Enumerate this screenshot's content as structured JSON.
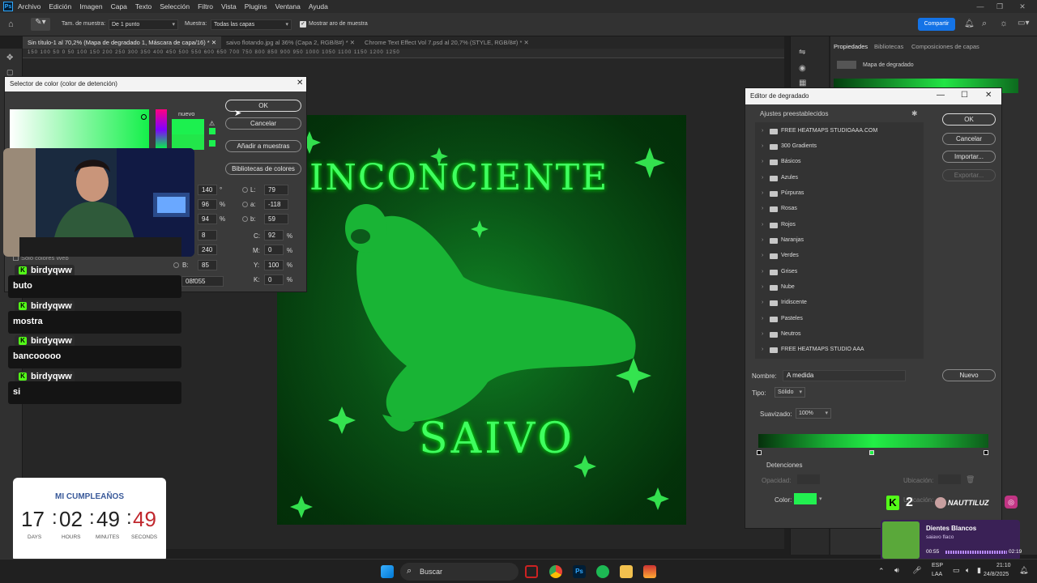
{
  "menubar": {
    "app_icon": "Ps",
    "items": [
      "Archivo",
      "Edición",
      "Imagen",
      "Capa",
      "Texto",
      "Selección",
      "Filtro",
      "Vista",
      "Plugins",
      "Ventana",
      "Ayuda"
    ]
  },
  "options": {
    "sample_size_label": "Tam. de muestra:",
    "sample_size_value": "De 1 punto",
    "sample_label": "Muestra:",
    "sample_value": "Todas las capas",
    "show_ring_label": "Mostrar aro de muestra",
    "share_label": "Compartir"
  },
  "tabs": [
    {
      "label": "Sin título-1 al 70,2% (Mapa de degradado 1, Máscara de capa/16) *"
    },
    {
      "label": "saivo flotando.jpg al 36% (Capa 2, RGB/8#) *"
    },
    {
      "label": "Chrome Text Effect Vol 7.psd al 20,7% (STYLE, RGB/8#) *"
    }
  ],
  "ruler_text": "150  100   50    0    50   100  150  200  250  300  350  400  450  500  550  600  650  700  750  800  850  900  950  1000  1050  1100  1150  1200  1250",
  "artwork": {
    "title_text": "INCONCIENTE",
    "bottom_text": "SAIVO"
  },
  "properties": {
    "tabs": [
      "Propiedades",
      "Bibliotecas",
      "Composiciones de capas"
    ],
    "layer_type": "Mapa de degradado"
  },
  "color_picker": {
    "title": "Selector de color (color de detención)",
    "new_label": "nuevo",
    "ok": "OK",
    "cancel": "Cancelar",
    "add_swatches": "Añadir a muestras",
    "libraries": "Bibliotecas de colores",
    "web_only": "Solo colores Web",
    "h": "140",
    "h_unit": "°",
    "s": "96",
    "s_unit": "%",
    "b_pct": "94",
    "b_unit": "%",
    "r": "8",
    "g": "240",
    "b_label": "B:",
    "b": "85",
    "hex_label": "#",
    "hex": "08f055",
    "L_label": "L:",
    "L": "79",
    "a_label": "a:",
    "a": "-118",
    "bb_label": "b:",
    "bb": "59",
    "C_label": "C:",
    "C": "92",
    "M_label": "M:",
    "M": "0",
    "Y_label": "Y:",
    "Y": "100",
    "K_label": "K:",
    "K": "0",
    "pct": "%",
    "new_color": "#1cf04f",
    "current_color": "#22e64a"
  },
  "chat": [
    {
      "user": "birdyqww",
      "msg": "buto"
    },
    {
      "user": "birdyqww",
      "msg": "mostra"
    },
    {
      "user": "birdyqww",
      "msg": "bancooooo"
    },
    {
      "user": "birdyqww",
      "msg": "si"
    }
  ],
  "countdown": {
    "title": "MI CUMPLEAÑOS",
    "days": "17",
    "hours": "02",
    "minutes": "49",
    "seconds": "49",
    "days_label": "DAYS",
    "hours_label": "HOURS",
    "minutes_label": "MINUTES",
    "seconds_label": "SECONDS",
    "sep": ":"
  },
  "gradient_editor": {
    "title": "Editor de degradado",
    "presets_label": "Ajustes preestablecidos",
    "presets": [
      "FREE HEATMAPS STUDIOAAA.COM",
      "300 Gradients",
      "Básicos",
      "Azules",
      "Púrpuras",
      "Rosas",
      "Rojos",
      "Naranjas",
      "Verdes",
      "Grises",
      "Nube",
      "Iridiscente",
      "Pasteles",
      "Neutros",
      "FREE HEATMAPS STUDIO AAA"
    ],
    "ok": "OK",
    "cancel": "Cancelar",
    "import": "Importar...",
    "export": "Exportar...",
    "name_label": "Nombre:",
    "name_value": "A medida",
    "new": "Nuevo",
    "type_label": "Tipo:",
    "type_value": "Sólido",
    "smooth_label": "Suavizado:",
    "smooth_value": "100%",
    "stops_label": "Detenciones",
    "opacity_label": "Opacidad:",
    "location_label": "Ubicación:",
    "color_label": "Color:",
    "location2_label": "Ubicación:",
    "stop_color": "#22f050"
  },
  "stream_overlay": {
    "viewer_count": "2",
    "streamer": "NAUTTILUZ",
    "song_title": "Dientes Blancos",
    "song_artist": "saiavo flaco",
    "elapsed": "00:55",
    "duration": "02:19"
  },
  "taskbar": {
    "search_placeholder": "Buscar",
    "lang": "ESP",
    "region": "LAA",
    "time": "21:10",
    "date": "24/8/2025"
  }
}
